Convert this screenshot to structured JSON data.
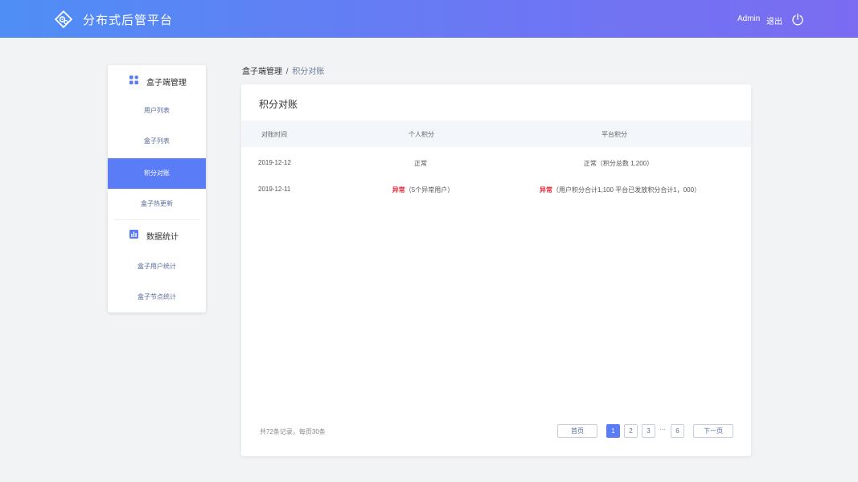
{
  "header": {
    "title": "分布式后管平台",
    "user": "Admin",
    "logout_label": "退出"
  },
  "sidebar": {
    "groups": [
      {
        "label": "盒子端管理",
        "icon": "grid-icon",
        "items": [
          "用户列表",
          "盒子列表",
          "积分对账",
          "盒子热更新"
        ]
      },
      {
        "label": "数据统计",
        "icon": "bar-chart-icon",
        "items": [
          "盒子用户统计",
          "盒子节点统计"
        ]
      }
    ],
    "active_item": "积分对账"
  },
  "breadcrumb": {
    "parent": "盒子端管理",
    "separator": "/",
    "current": "积分对账"
  },
  "panel": {
    "title": "积分对账",
    "table": {
      "headers": [
        "对账时间",
        "个人积分",
        "平台积分"
      ],
      "rows": [
        {
          "date": "2019-12-12",
          "personal_status": "正常",
          "personal_detail": "",
          "platform_status": "正常",
          "platform_detail": "（积分总数 1,200）"
        },
        {
          "date": "2019-12-11",
          "personal_status": "异常",
          "personal_detail": "（5个异常用户）",
          "platform_status": "异常",
          "platform_detail": "（用户积分合计1,100  平台已发放积分合计1，000）"
        }
      ]
    },
    "pagination": {
      "total_text": "共72条记录，每页30条",
      "first_label": "首页",
      "pages": [
        "1",
        "2",
        "3"
      ],
      "ellipsis": "···",
      "last_page": "6",
      "next_label": "下一页",
      "current_page": "1"
    }
  },
  "colors": {
    "header_gradient_start": "#4f8ef5",
    "header_gradient_end": "#7b6cf2",
    "accent": "#5b7cf7",
    "error": "#e8293b"
  }
}
